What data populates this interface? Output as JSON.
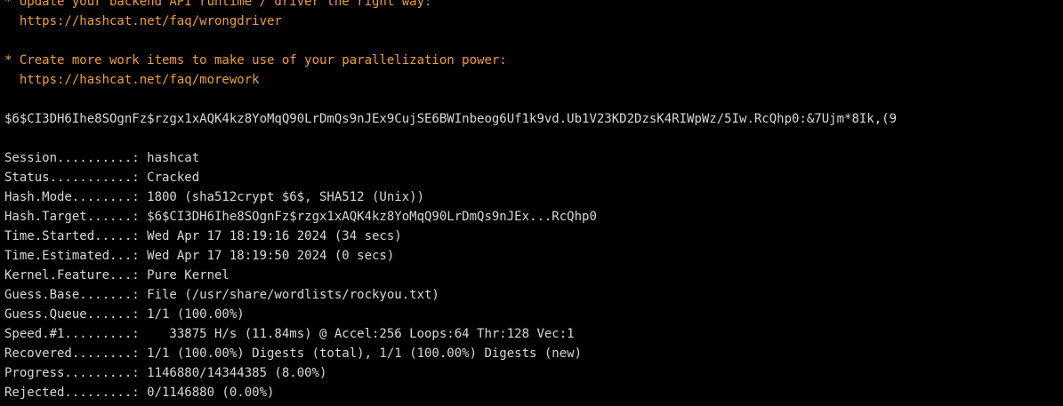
{
  "warnings": [
    "* Update your backend API runtime / driver the right way:",
    "  https://hashcat.net/faq/wrongdriver",
    "",
    "* Create more work items to make use of your parallelization power:",
    "  https://hashcat.net/faq/morework"
  ],
  "cracked_line": "$6$CI3DH6Ihe8SOgnFz$rzgx1xAQK4kz8YoMqQ90LrDmQs9nJEx9CujSE6BWInbeog6Uf1k9vd.Ub1V23KD2DzsK4RIWpWz/5Iw.RcQhp0:&7Ujm*8Ik,(9",
  "status_lines": [
    "Session..........: hashcat",
    "Status...........: Cracked",
    "Hash.Mode........: 1800 (sha512crypt $6$, SHA512 (Unix))",
    "Hash.Target......: $6$CI3DH6Ihe8SOgnFz$rzgx1xAQK4kz8YoMqQ90LrDmQs9nJEx...RcQhp0",
    "Time.Started.....: Wed Apr 17 18:19:16 2024 (34 secs)",
    "Time.Estimated...: Wed Apr 17 18:19:50 2024 (0 secs)",
    "Kernel.Feature...: Pure Kernel",
    "Guess.Base.......: File (/usr/share/wordlists/rockyou.txt)",
    "Guess.Queue......: 1/1 (100.00%)",
    "Speed.#1.........:    33875 H/s (11.84ms) @ Accel:256 Loops:64 Thr:128 Vec:1",
    "Recovered........: 1/1 (100.00%) Digests (total), 1/1 (100.00%) Digests (new)",
    "Progress.........: 1146880/14344385 (8.00%)",
    "Rejected.........: 0/1146880 (0.00%)"
  ],
  "colors": {
    "background": "#000000",
    "text": "#d8d8d8",
    "warning": "#f0a030"
  }
}
